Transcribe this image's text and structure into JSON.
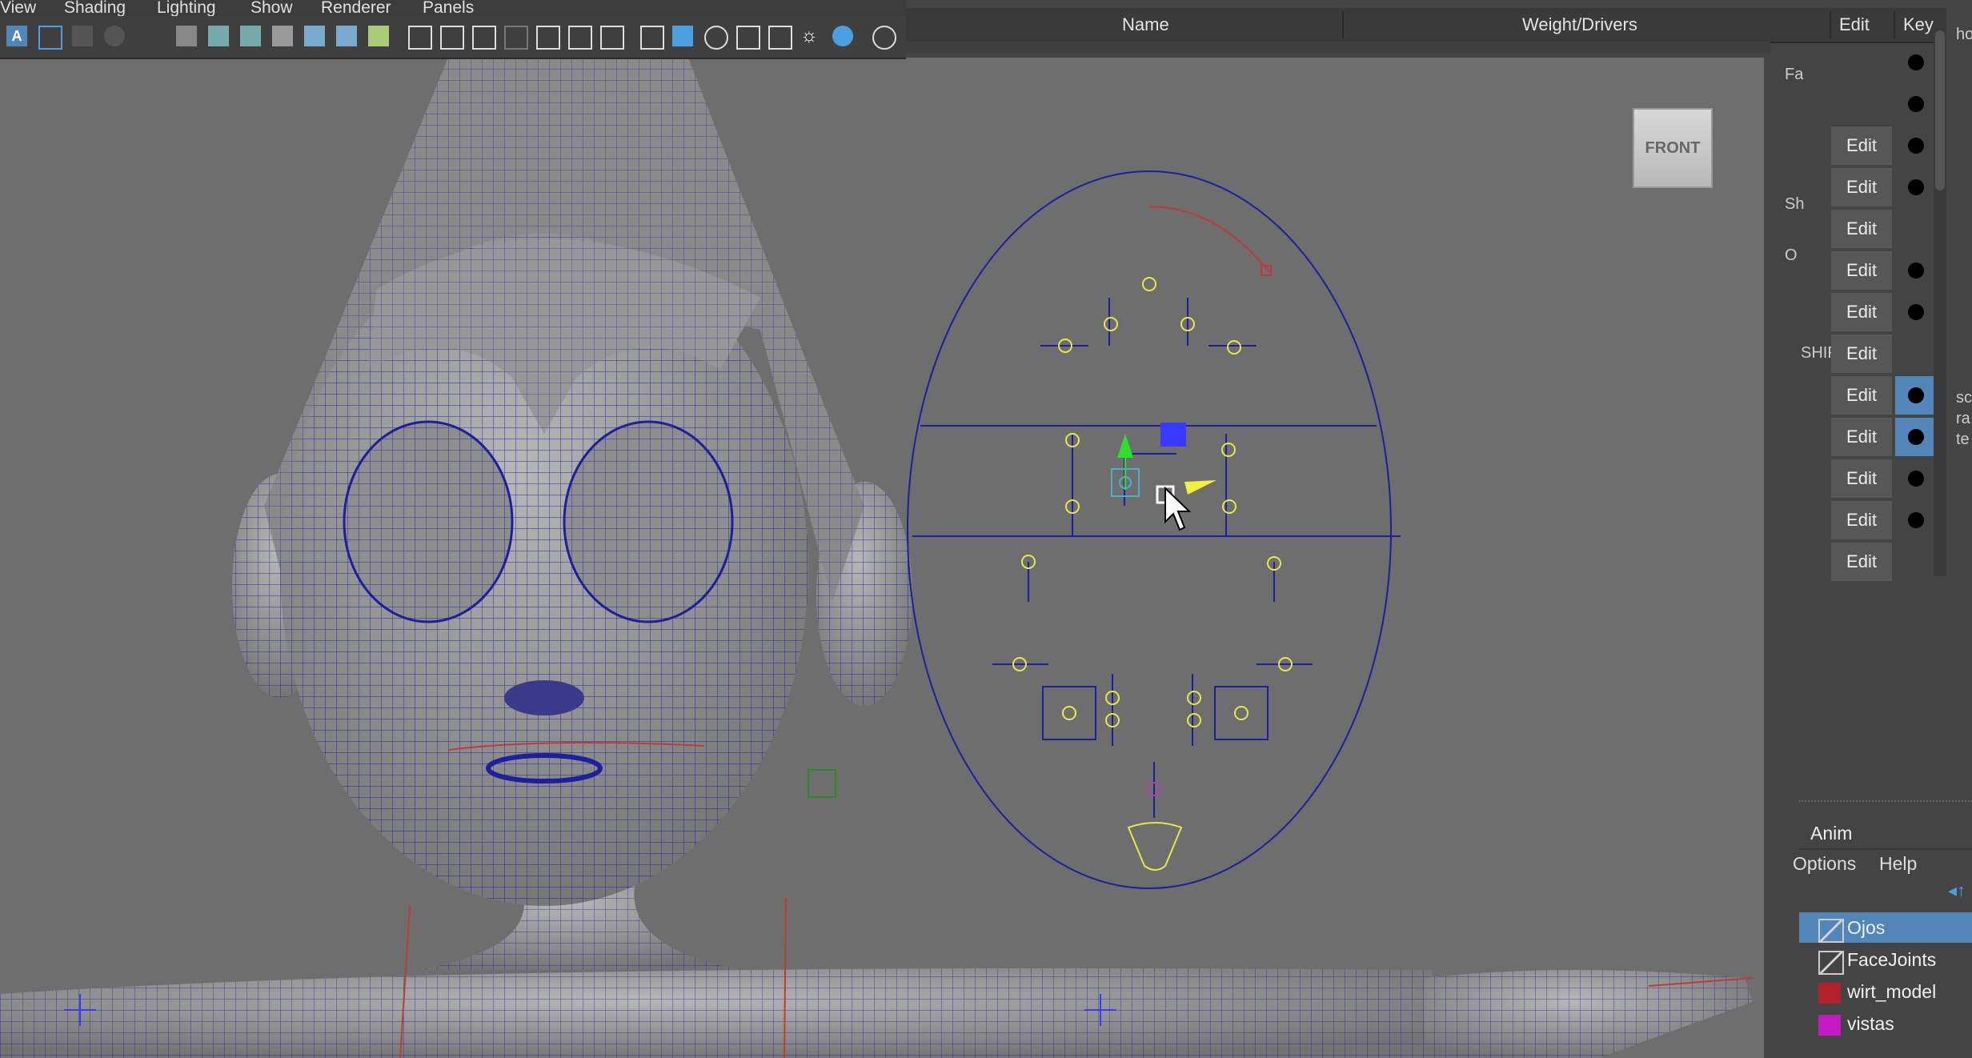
{
  "menu": [
    "View",
    "Shading",
    "Lighting",
    "Show",
    "Renderer",
    "Panels"
  ],
  "viewport": {
    "camera_label": "FRONT"
  },
  "editor": {
    "columns": {
      "name": "Name",
      "weight": "Weight/Drivers",
      "edit": "Edit",
      "key": "Key"
    },
    "rows": [
      {
        "edit": "",
        "key": true,
        "selected": false
      },
      {
        "edit": "",
        "key": true,
        "selected": false
      },
      {
        "edit": "Edit",
        "key": true,
        "selected": false
      },
      {
        "edit": "Edit",
        "key": true,
        "selected": false
      },
      {
        "edit": "Edit",
        "key": false,
        "selected": false
      },
      {
        "edit": "Edit",
        "key": true,
        "selected": false
      },
      {
        "edit": "Edit",
        "key": true,
        "selected": false
      },
      {
        "edit": "Edit",
        "key": false,
        "selected": false
      },
      {
        "edit": "Edit",
        "key": true,
        "selected": true
      },
      {
        "edit": "Edit",
        "key": true,
        "selected": true
      },
      {
        "edit": "Edit",
        "key": true,
        "selected": false
      },
      {
        "edit": "Edit",
        "key": true,
        "selected": false
      },
      {
        "edit": "Edit",
        "key": false,
        "selected": false
      }
    ],
    "partial_labels": {
      "fa": "Fa",
      "sh": "Sh",
      "o": "O",
      "ship": "SHIP"
    }
  },
  "right_panel": {
    "partial_text": [
      "ho",
      "sc",
      "ra",
      "te"
    ]
  },
  "layers": {
    "tabs": {
      "anim": "Anim"
    },
    "menu": {
      "options": "Options",
      "help": "Help"
    },
    "items": [
      {
        "name": "Ojos",
        "color": "#5285b8",
        "selected": true
      },
      {
        "name": "FaceJoints",
        "color": "",
        "selected": false
      },
      {
        "name": "wirt_model",
        "color": "#b3222b",
        "selected": false
      },
      {
        "name": "vistas",
        "color": "#c21bc4",
        "selected": false
      }
    ]
  },
  "colors": {
    "selection": "#5285b8",
    "wire": "#1e1e9e",
    "controls": "#e8e84a",
    "axis_y": "#2ce02c",
    "axis_x": "#f0f040",
    "handle": "#3a3aff"
  }
}
